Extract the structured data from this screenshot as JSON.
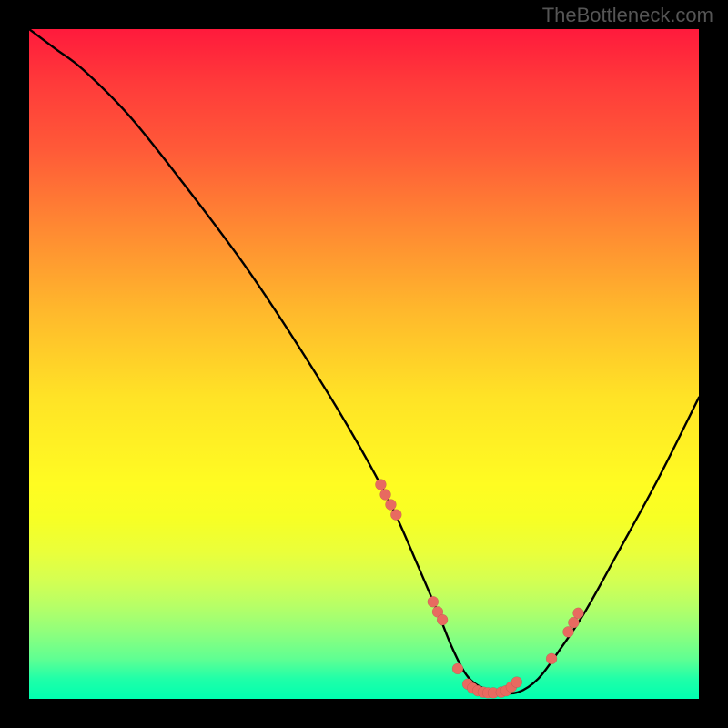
{
  "watermark": "TheBottleneck.com",
  "chart_data": {
    "type": "line",
    "title": "",
    "xlabel": "",
    "ylabel": "",
    "xlim": [
      0,
      100
    ],
    "ylim": [
      0,
      100
    ],
    "curve": {
      "x": [
        0,
        4,
        8,
        15,
        23,
        32,
        40,
        48,
        54,
        58,
        61,
        63,
        65,
        67,
        70,
        73,
        76,
        79,
        83,
        88,
        94,
        100
      ],
      "y": [
        100,
        97,
        94,
        87,
        77,
        65,
        53,
        40,
        29,
        20,
        13,
        8,
        4,
        2,
        1,
        1,
        3,
        7,
        13,
        22,
        33,
        45
      ]
    },
    "scatter_points": {
      "x": [
        52.5,
        53.2,
        54.0,
        54.8,
        60.3,
        61.0,
        61.7,
        64.0,
        65.5,
        66.2,
        67.0,
        67.8,
        68.5,
        69.3,
        70.5,
        71.2,
        72.0,
        72.8,
        78.0,
        80.5,
        81.3,
        82.0
      ],
      "y": [
        32.0,
        30.5,
        29.0,
        27.5,
        14.5,
        13.0,
        11.8,
        4.5,
        2.2,
        1.6,
        1.2,
        1.0,
        0.9,
        0.9,
        1.0,
        1.2,
        1.8,
        2.5,
        6.0,
        10.0,
        11.4,
        12.8
      ]
    },
    "background_gradient": {
      "top": "#ff1a3c",
      "bottom": "#00ffb0"
    }
  }
}
